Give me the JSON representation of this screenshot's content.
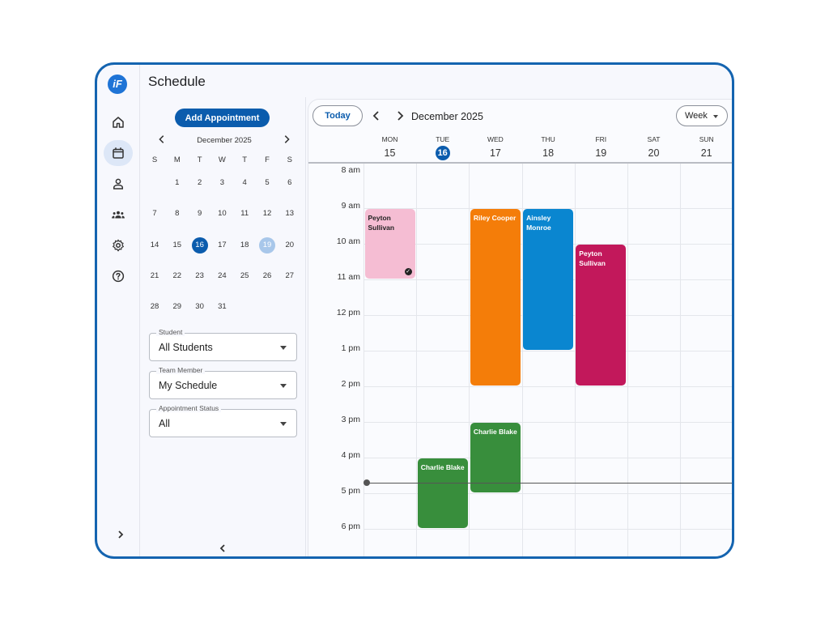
{
  "app": {
    "title": "Schedule",
    "logo_text": "iF"
  },
  "rail": {
    "items": [
      {
        "name": "home",
        "icon": "home-icon"
      },
      {
        "name": "calendar",
        "icon": "calendar-icon",
        "active": true
      },
      {
        "name": "person",
        "icon": "person-icon"
      },
      {
        "name": "group",
        "icon": "group-icon"
      },
      {
        "name": "settings",
        "icon": "gear-icon"
      },
      {
        "name": "help",
        "icon": "help-icon"
      }
    ]
  },
  "panel": {
    "add_button": "Add Appointment",
    "mini_calendar": {
      "month": "December 2025",
      "dow": [
        "S",
        "M",
        "T",
        "W",
        "T",
        "F",
        "S"
      ],
      "weeks": [
        [
          "",
          "1",
          "2",
          "3",
          "4",
          "5",
          "6"
        ],
        [
          "7",
          "8",
          "9",
          "10",
          "11",
          "12",
          "13"
        ],
        [
          "14",
          "15",
          "16",
          "17",
          "18",
          "19",
          "20"
        ],
        [
          "21",
          "22",
          "23",
          "24",
          "25",
          "26",
          "27"
        ],
        [
          "28",
          "29",
          "30",
          "31",
          "",
          "",
          ""
        ]
      ],
      "selected": "16",
      "highlighted": "19"
    },
    "filters": [
      {
        "label": "Student",
        "value": "All Students"
      },
      {
        "label": "Team Member",
        "value": "My Schedule"
      },
      {
        "label": "Appointment Status",
        "value": "All"
      }
    ]
  },
  "calendar": {
    "today_button": "Today",
    "month_label": "December 2025",
    "view": "Week",
    "days": [
      {
        "name": "MON",
        "date": "15"
      },
      {
        "name": "TUE",
        "date": "16",
        "today": true
      },
      {
        "name": "WED",
        "date": "17"
      },
      {
        "name": "THU",
        "date": "18"
      },
      {
        "name": "FRI",
        "date": "19"
      },
      {
        "name": "SAT",
        "date": "20"
      },
      {
        "name": "SUN",
        "date": "21"
      }
    ],
    "hours": [
      "8 am",
      "9 am",
      "10 am",
      "11 am",
      "12 pm",
      "1 pm",
      "2 pm",
      "3 pm",
      "4 pm",
      "5 pm",
      "6 pm"
    ],
    "current_time_hour": 16.7,
    "events": [
      {
        "title": "Peyton Sullivan",
        "day": 0,
        "start": 9,
        "end": 11,
        "color": "#f5bdd3",
        "text_color": "#222222",
        "completed": true
      },
      {
        "title": "Riley Cooper",
        "day": 2,
        "start": 9,
        "end": 14,
        "color": "#f47d09",
        "text_color": "#ffffff"
      },
      {
        "title": "Ainsley Monroe",
        "day": 3,
        "start": 9,
        "end": 13,
        "color": "#0a86d0",
        "text_color": "#ffffff"
      },
      {
        "title": "Peyton Sullivan",
        "day": 4,
        "start": 10,
        "end": 14,
        "color": "#c2185b",
        "text_color": "#ffffff"
      },
      {
        "title": "Charlie Blake",
        "day": 2,
        "start": 15,
        "end": 17,
        "color": "#388e3c",
        "text_color": "#ffffff"
      },
      {
        "title": "Charlie Blake",
        "day": 1,
        "start": 16,
        "end": 18,
        "color": "#388e3c",
        "text_color": "#ffffff"
      }
    ]
  },
  "colors": {
    "accent": "#0b5cad",
    "frame": "#1464b0",
    "today_highlight": "#a8c7ea"
  }
}
